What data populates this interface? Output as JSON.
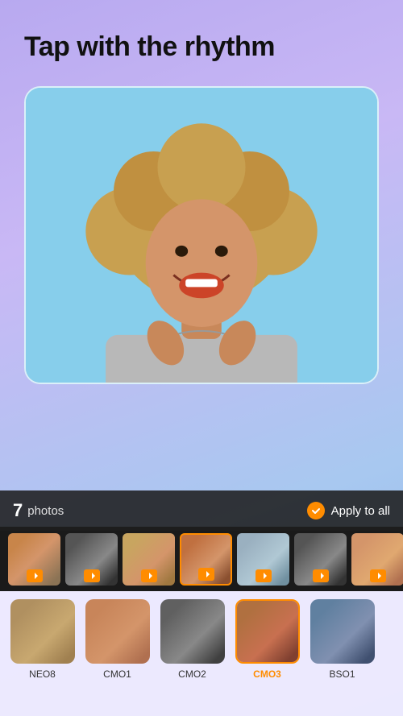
{
  "header": {
    "title": "Tap with the rhythm"
  },
  "bottom_bar": {
    "photos_count": "7",
    "photos_label": "photos",
    "apply_label": "Apply to all"
  },
  "photo_strip": {
    "items": [
      {
        "id": "strip-1",
        "active": false,
        "color": "color-strip1"
      },
      {
        "id": "strip-2",
        "active": false,
        "color": "color-strip2"
      },
      {
        "id": "strip-3",
        "active": false,
        "color": "color-strip3"
      },
      {
        "id": "strip-4",
        "active": true,
        "color": "color-strip-active"
      },
      {
        "id": "strip-5",
        "active": false,
        "color": "color-strip4"
      },
      {
        "id": "strip-6",
        "active": false,
        "color": "color-strip2"
      },
      {
        "id": "strip-7",
        "active": false,
        "color": "color-strip5"
      }
    ]
  },
  "filters": [
    {
      "id": "neo8",
      "label": "NEO8",
      "selected": false,
      "color": "neo8-color"
    },
    {
      "id": "cmo1",
      "label": "CMO1",
      "selected": false,
      "color": "cmo1-color"
    },
    {
      "id": "cmo2",
      "label": "CMO2",
      "selected": false,
      "color": "cmo2-color"
    },
    {
      "id": "cmo3",
      "label": "CMO3",
      "selected": true,
      "color": "cmo3-color"
    },
    {
      "id": "bso1",
      "label": "BSO1",
      "selected": false,
      "color": "bso1-color"
    }
  ]
}
